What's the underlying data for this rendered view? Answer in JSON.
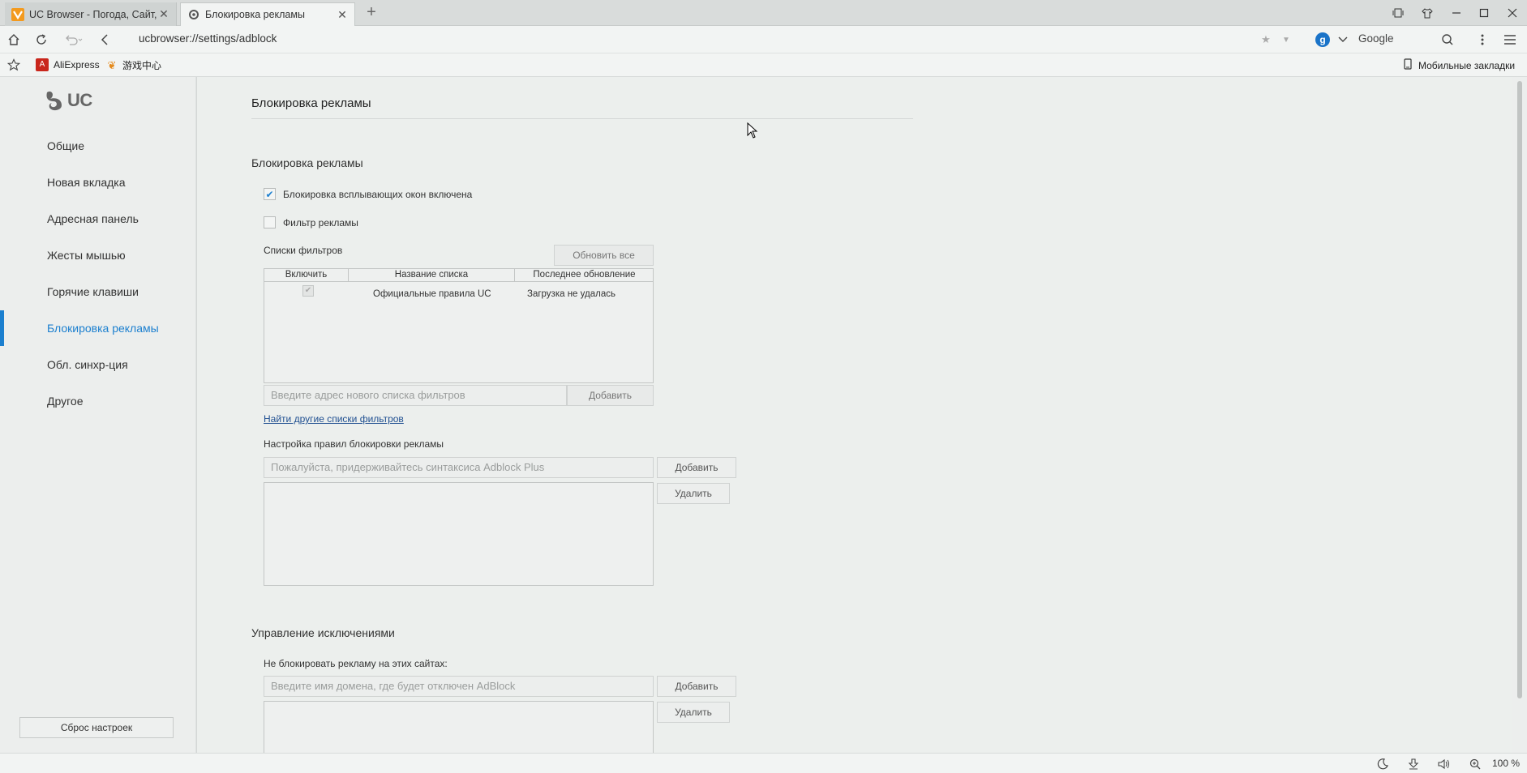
{
  "tabs": [
    {
      "title": "UC Browser - Погода, Сайт, Н",
      "active": false
    },
    {
      "title": "Блокировка рекламы",
      "active": true
    }
  ],
  "address": {
    "url": "ucbrowser://settings/adblock",
    "search_engine": "Google"
  },
  "bookmarks": {
    "items": [
      {
        "label": "AliExpress"
      },
      {
        "label": "游戏中心"
      }
    ],
    "mobile_label": "Мобильные закладки"
  },
  "sidebar": {
    "logo_text": "UC",
    "items": [
      {
        "label": "Общие"
      },
      {
        "label": "Новая вкладка"
      },
      {
        "label": "Адресная панель"
      },
      {
        "label": "Жесты мышью"
      },
      {
        "label": "Горячие клавиши"
      },
      {
        "label": "Блокировка рекламы",
        "active": true
      },
      {
        "label": "Обл. синхр-ция"
      },
      {
        "label": "Другое"
      }
    ],
    "reset_label": "Сброс настроек"
  },
  "main": {
    "page_title": "Блокировка рекламы",
    "adblock_section": "Блокировка рекламы",
    "popup_checkbox": {
      "label": "Блокировка всплывающих окон включена",
      "checked": true
    },
    "filter_checkbox": {
      "label": "Фильтр рекламы",
      "checked": false
    },
    "filter_lists_label": "Списки фильтров",
    "update_all_label": "Обновить все",
    "table": {
      "headers": [
        "Включить",
        "Название списка",
        "Последнее обновление"
      ],
      "rows": [
        {
          "enabled": true,
          "name": "Официальные правила UC",
          "updated": "Загрузка не удалась"
        }
      ]
    },
    "new_list_placeholder": "Введите адрес нового списка фильтров",
    "add_list_label": "Добавить",
    "find_lists_link": "Найти другие списки фильтров",
    "rules_label": "Настройка правил блокировки рекламы",
    "rules_placeholder": "Пожалуйста, придерживайтесь синтаксиса Adblock Plus",
    "rules_add_label": "Добавить",
    "rules_delete_label": "Удалить",
    "exceptions_section": "Управление исключениями",
    "exceptions_label": "Не блокировать рекламу на этих сайтах:",
    "exceptions_placeholder": "Введите имя домена, где будет отключен AdBlock",
    "exceptions_add_label": "Добавить",
    "exceptions_delete_label": "Удалить"
  },
  "status": {
    "zoom": "100 %"
  },
  "colors": {
    "accent": "#1b7fcf",
    "background": "#ecefed"
  }
}
